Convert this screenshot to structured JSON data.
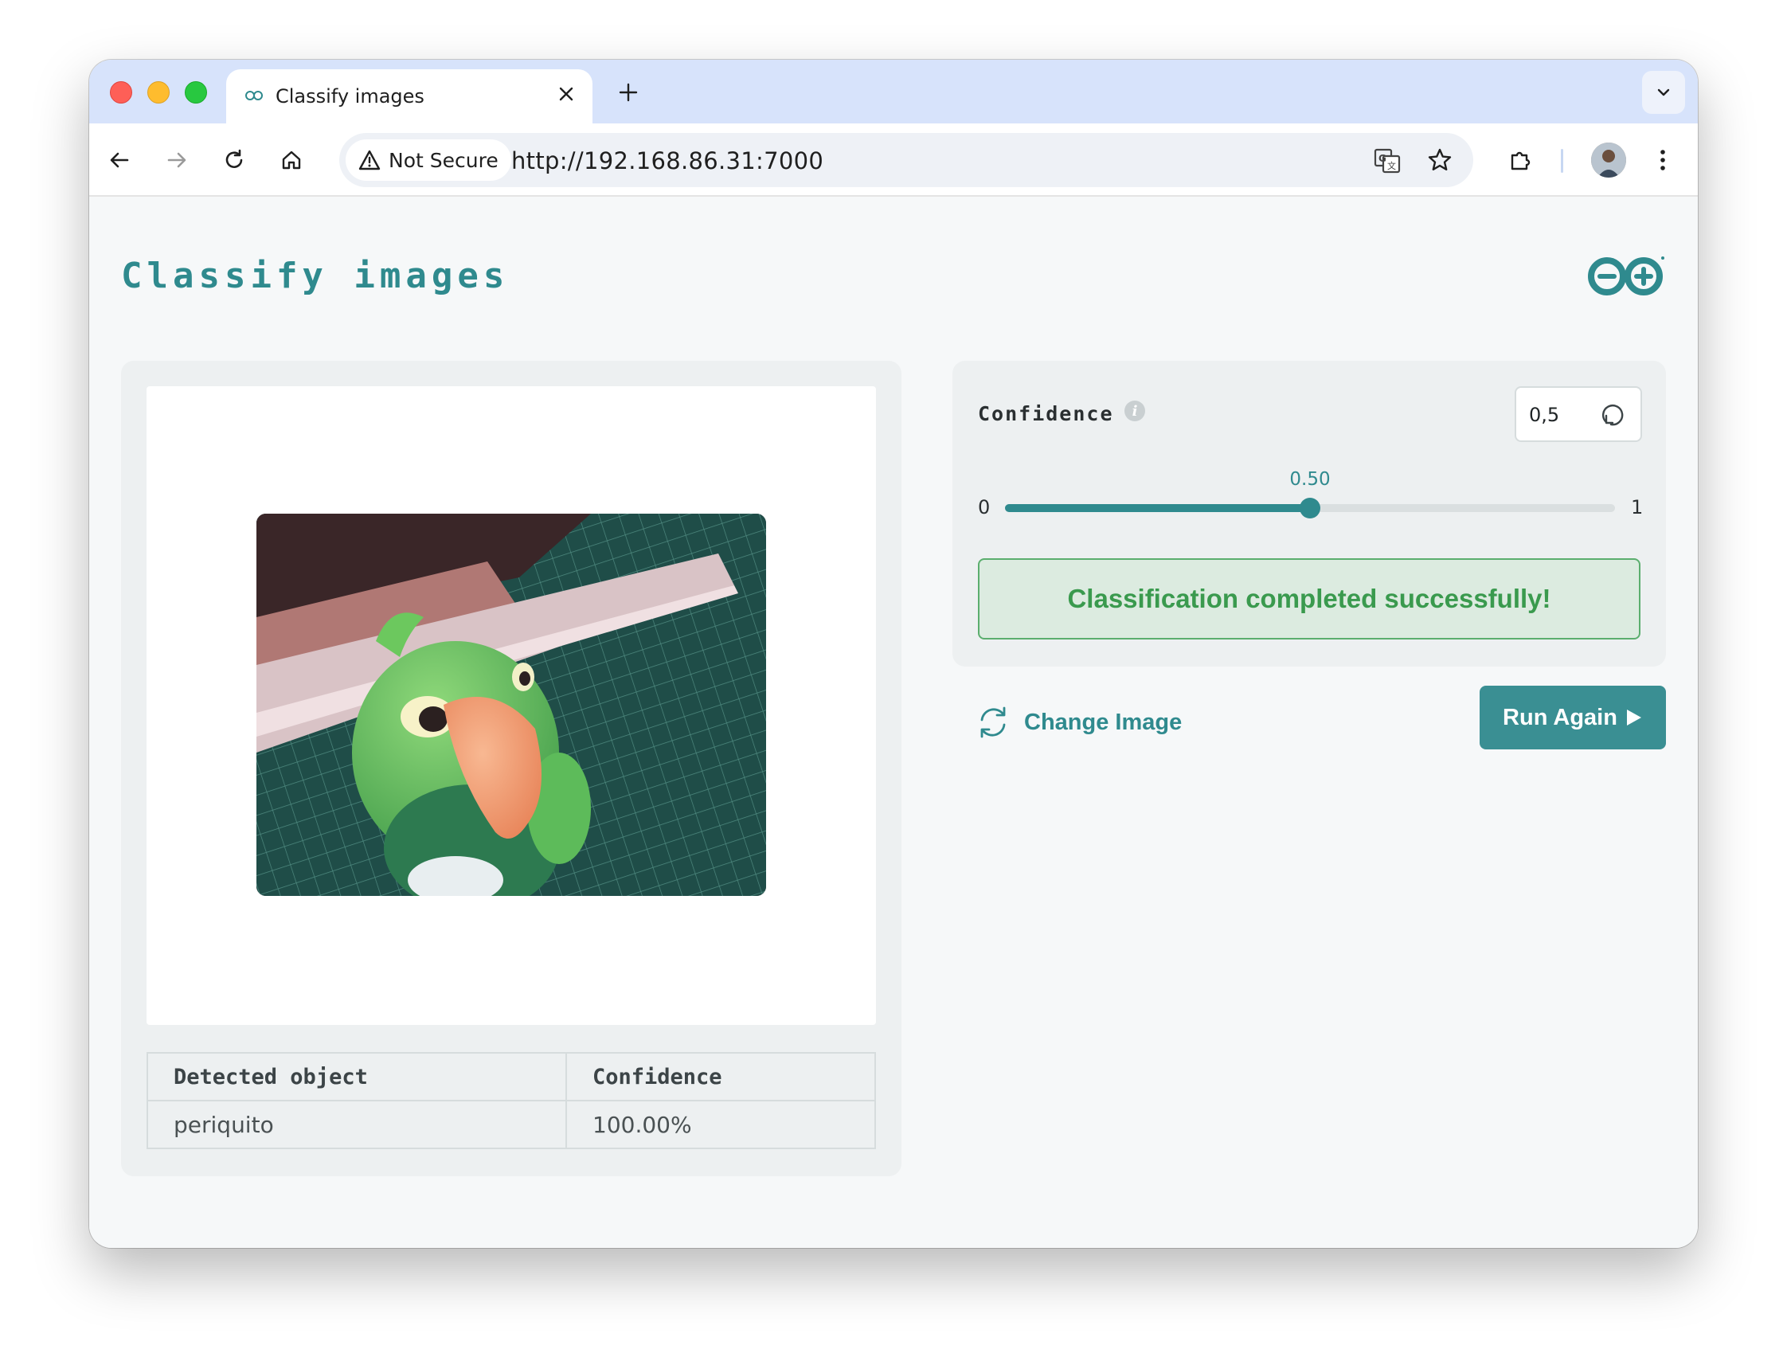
{
  "browser": {
    "tab_title": "Classify images",
    "not_secure_label": "Not Secure",
    "url": "http://192.168.86.31:7000"
  },
  "page": {
    "title": "Classify images"
  },
  "results": {
    "columns": [
      "Detected object",
      "Confidence"
    ],
    "rows": [
      {
        "object": "periquito",
        "confidence": "100.00%"
      }
    ]
  },
  "confidence": {
    "label": "Confidence",
    "input_value": "0,5",
    "slider_min": "0",
    "slider_max": "1",
    "slider_value": 0.5,
    "slider_value_label": "0.50"
  },
  "status": {
    "message": "Classification completed successfully!"
  },
  "actions": {
    "change_image": "Change Image",
    "run_again": "Run Again"
  },
  "colors": {
    "accent": "#2f8a8e",
    "button": "#3a8f93",
    "success_text": "#3a9a4e",
    "success_bg": "#dcebe0"
  }
}
